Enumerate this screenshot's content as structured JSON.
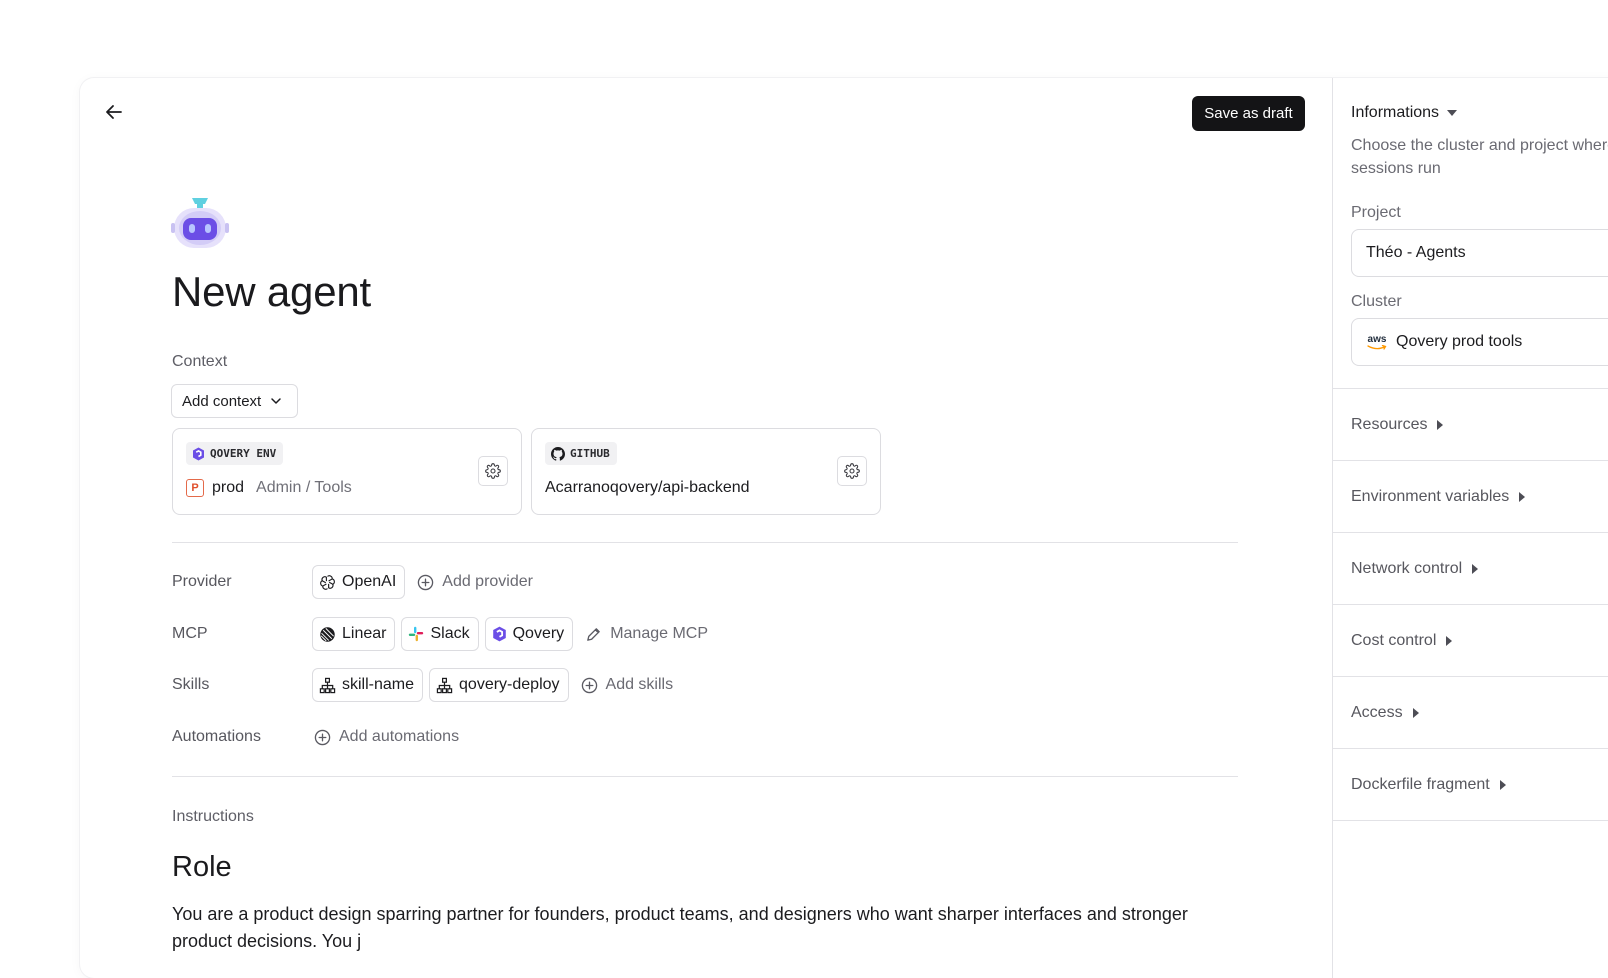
{
  "header": {
    "save_draft_label": "Save as draft"
  },
  "page": {
    "title": "New agent"
  },
  "context": {
    "label": "Context",
    "add_context_label": "Add context",
    "cards": [
      {
        "badge": "QOVERY ENV",
        "prefix": "P",
        "value": "prod",
        "path": "Admin / Tools"
      },
      {
        "badge": "GITHUB",
        "value": "Acarranoqovery/api-backend"
      }
    ]
  },
  "provider": {
    "label": "Provider",
    "items": [
      "OpenAI"
    ],
    "add_label": "Add provider"
  },
  "mcp": {
    "label": "MCP",
    "items": [
      "Linear",
      "Slack",
      "Qovery"
    ],
    "manage_label": "Manage MCP"
  },
  "skills": {
    "label": "Skills",
    "items": [
      "skill-name",
      "qovery-deploy"
    ],
    "add_label": "Add skills"
  },
  "automations": {
    "label": "Automations",
    "add_label": "Add automations"
  },
  "instructions": {
    "label": "Instructions",
    "heading": "Role",
    "text": "You are a product design sparring partner for founders, product teams, and designers who want sharper interfaces and stronger product decisions. You j"
  },
  "sidebar": {
    "informations_label": "Informations",
    "description": "Choose the cluster and project where its sessions run",
    "project_label": "Project",
    "project_value": "Théo - Agents",
    "cluster_label": "Cluster",
    "cluster_logo_text": "aws",
    "cluster_value": "Qovery prod tools",
    "sections": [
      "Resources",
      "Environment variables",
      "Network control",
      "Cost control",
      "Access",
      "Dockerfile fragment"
    ]
  },
  "colors": {
    "accent": "#6b4ee6",
    "dark": "#141416",
    "openai": "#1c1c1f",
    "aws_orange": "#ff9900"
  },
  "icons": {
    "back": "arrow-left-icon",
    "robot": "robot-avatar-icon",
    "chevron": "chevron-down-icon",
    "gear": "gear-icon",
    "github": "github-icon",
    "qovery": "qovery-icon",
    "plus": "plus-circle-icon",
    "pencil": "pencil-icon",
    "skill": "hierarchy-icon"
  }
}
